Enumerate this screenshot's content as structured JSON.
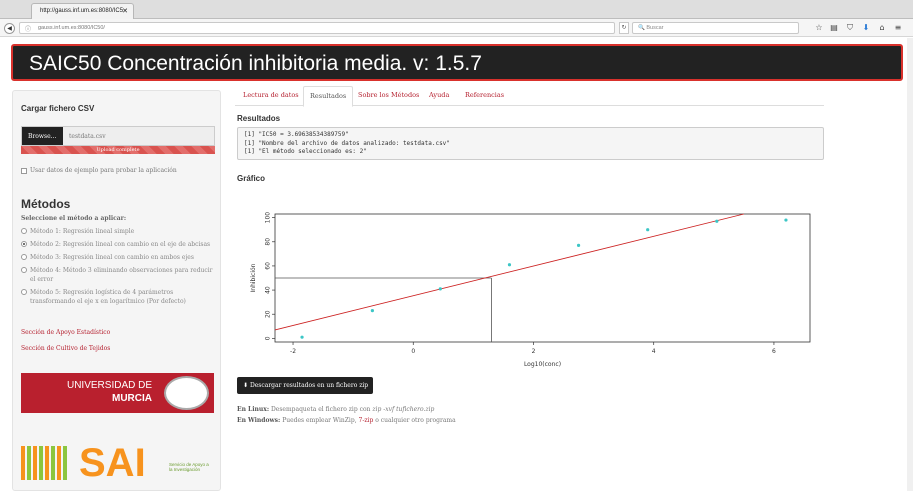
{
  "browser": {
    "tab_title": "http://gauss.inf.um.es:8080/IC5",
    "url": "gauss.inf.um.es:8080/IC50/",
    "search_placeholder": "Buscar"
  },
  "app": {
    "title": "SAIC50 Concentración inhibitoria media. v: 1.5.7"
  },
  "sidebar": {
    "upload_heading": "Cargar fichero CSV",
    "browse_label": "Browse...",
    "file_name": "testdata.csv",
    "upload_status": "Upload complete",
    "example_checkbox": "Usar datos de ejemplo para probar la aplicación",
    "methods_heading": "Métodos",
    "methods_label": "Seleccione el método a aplicar:",
    "methods": [
      "Método 1: Regresión lineal simple",
      "Método 2: Regresión lineal con cambio en el eje de abcisas",
      "Método 3: Regresión lineal con cambio en ambos ejes",
      "Método 4: Método 3 eliminando observaciones para reducir el error",
      "Método 5: Regresión logística de 4 parámetros transformando el eje x en logarítmico (Por defecto)"
    ],
    "selected_method_index": 1,
    "links": [
      "Sección de Apoyo Estadístico",
      "Sección de Cultivo de Tejidos"
    ],
    "logo1_line1": "UNIVERSIDAD DE",
    "logo1_line2": "MURCIA",
    "logo2_text": "SAI",
    "logo2_sub": "Servicio de Apoyo a la Investigación"
  },
  "main": {
    "tabs": [
      "Lectura de datos",
      "Resultados",
      "Sobre los Métodos",
      "Ayuda",
      "Referencias"
    ],
    "active_tab_index": 1,
    "results_heading": "Resultados",
    "results_lines": [
      "[1] \"IC50 = 3.69638534389759\"",
      "[1] \"Nombre del archivo de datos analizado: testdata.csv\"",
      "[1] \"El método seleccionado es: 2\""
    ],
    "chart_heading": "Gráfico",
    "download_label": "Descargar resultados en un fichero zip",
    "note_linux_label": "En Linux:",
    "note_linux_text": "Desempaqueta el fichero zip con",
    "note_linux_cmd": "zip -xvf tufichero.zip",
    "note_windows_label": "En Windows:",
    "note_windows_pre": "Puedes emplear WinZip,",
    "note_windows_link": "7-zip",
    "note_windows_post": "o cualquier otro programa"
  },
  "chart_data": {
    "type": "scatter",
    "xlabel": "Log10(conc)",
    "ylabel": "Inhibición",
    "xlim": [
      -2.3,
      6.6
    ],
    "ylim": [
      -3,
      103
    ],
    "x_ticks": [
      -2,
      0,
      2,
      4,
      6
    ],
    "y_ticks": [
      0,
      20,
      40,
      60,
      80,
      100
    ],
    "points": [
      {
        "x": -1.85,
        "y": 1
      },
      {
        "x": -0.68,
        "y": 23
      },
      {
        "x": 0.45,
        "y": 41
      },
      {
        "x": 1.6,
        "y": 61
      },
      {
        "x": 2.75,
        "y": 77
      },
      {
        "x": 3.9,
        "y": 90
      },
      {
        "x": 5.05,
        "y": 97
      },
      {
        "x": 6.2,
        "y": 98
      }
    ],
    "regression_line": {
      "x": [
        -2.3,
        5.5
      ],
      "y": [
        7,
        103
      ]
    },
    "ic50_marker": {
      "x": 1.3,
      "y": 50
    },
    "colors": {
      "points": "#3cc6c6",
      "line": "#cc2222",
      "marker": "#555555"
    }
  }
}
